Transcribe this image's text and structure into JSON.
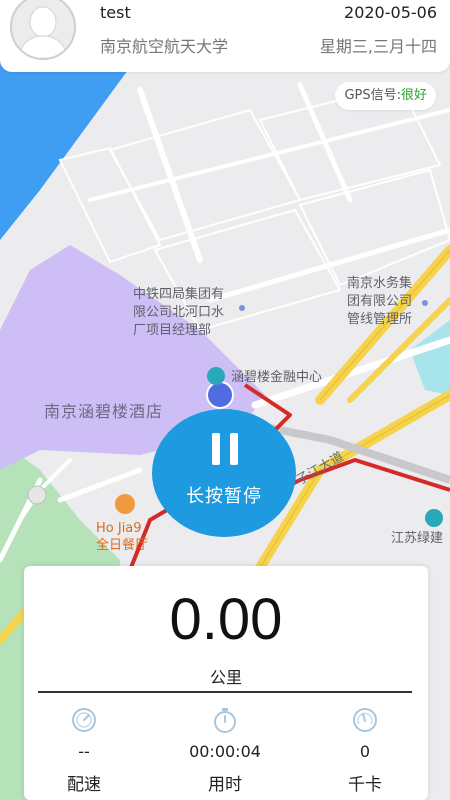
{
  "header": {
    "user_name": "test",
    "school": "南京航空航天大学",
    "date": "2020-05-06",
    "weekday": "星期三,三月十四"
  },
  "gps": {
    "label": "GPS信号:",
    "status": "很好",
    "status_color": "#27a52b"
  },
  "map": {
    "poi_1": "中铁四局集团有\n限公司北河口水\n厂项目经理部",
    "poi_2": "南京水务集\n团有限公司\n管线管理所",
    "poi_3": "涵碧楼金融中心",
    "poi_4": "南京涵碧楼酒店",
    "poi_5": "Ho Jia9\n全日餐厅",
    "poi_6": "江苏绿建",
    "road": "子江大道",
    "route_color": "#d42a2a",
    "water_color": "#3f9df2",
    "park_color": "#c9bff5"
  },
  "pause_button": {
    "label": "长按暂停",
    "color": "#1d9ae0"
  },
  "stats": {
    "distance": "0.00",
    "distance_unit": "公里",
    "pace_value": "--",
    "pace_label": "配速",
    "time_value": "00:00:04",
    "time_label": "用时",
    "calorie_value": "0",
    "calorie_label": "千卡"
  }
}
